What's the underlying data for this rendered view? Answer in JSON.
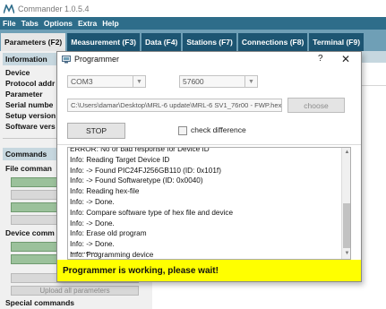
{
  "app": {
    "title": "Commander 1.0.5.4"
  },
  "menu": {
    "items": [
      "File",
      "Tabs",
      "Options",
      "Extra",
      "Help"
    ]
  },
  "tabs": [
    {
      "label": "Parameters (F2)",
      "active": true
    },
    {
      "label": "Measurement (F3)",
      "active": false
    },
    {
      "label": "Data (F4)",
      "active": false
    },
    {
      "label": "Stations (F7)",
      "active": false
    },
    {
      "label": "Connections (F8)",
      "active": false
    },
    {
      "label": "Terminal (F9)",
      "active": false
    }
  ],
  "left": {
    "information_header": "Information",
    "info_labels": [
      "Device",
      "Protocol addr",
      "Parameter",
      "Serial numbe",
      "Setup version",
      "Software vers"
    ],
    "commands_header": "Commands",
    "file_commands_label": "File comman",
    "file_buttons": [
      {
        "label": "Ope",
        "disabled": false
      },
      {
        "label": "Sav",
        "disabled": true
      },
      {
        "label": "Open d",
        "disabled": false
      },
      {
        "label": "Save d",
        "disabled": true
      }
    ],
    "device_commands_label": "Device comm",
    "device_buttons": [
      {
        "label": "Download p",
        "disabled": false
      },
      {
        "label": "Download a",
        "disabled": false
      },
      {
        "label": "Upload",
        "disabled": true
      },
      {
        "label": "Upload all parameters",
        "disabled": true
      }
    ],
    "special_commands_label": "Special commands"
  },
  "dialog": {
    "title": "Programmer",
    "help_glyph": "?",
    "close_glyph": "✕",
    "port": "COM3",
    "baud": "57600",
    "hex_path": "C:\\Users\\damar\\Desktop\\MRL-6 update\\MRL-6 SV1_76r00 - FWP.hex",
    "choose_label": "choose",
    "stop_label": "STOP",
    "check_difference_label": "check difference",
    "check_difference_checked": false,
    "log": [
      "ERROR: No or bad response for Device ID",
      "Info:  Reading Target Device ID",
      "Info:  -> Found PIC24FJ256GB110 (ID: 0x101f)",
      "Info:  -> Found Softwaretype (ID: 0x0040)",
      "Info:  Reading hex-file",
      "Info:  -> Done.",
      "Info:  Compare software type of hex file and device",
      "Info:  -> Done.",
      "Info:  Erase old program",
      "Info:  -> Done.",
      "Info:  Programming device"
    ],
    "status": "Programmer is working, please wait!",
    "status_color": "#ffff00"
  },
  "colors": {
    "menubar": "#2e6d8a",
    "tabbar": "#6f9fb6",
    "tab": "#1d5572",
    "panel_header": "#c6d7df",
    "button_green": "#9bc19b"
  }
}
